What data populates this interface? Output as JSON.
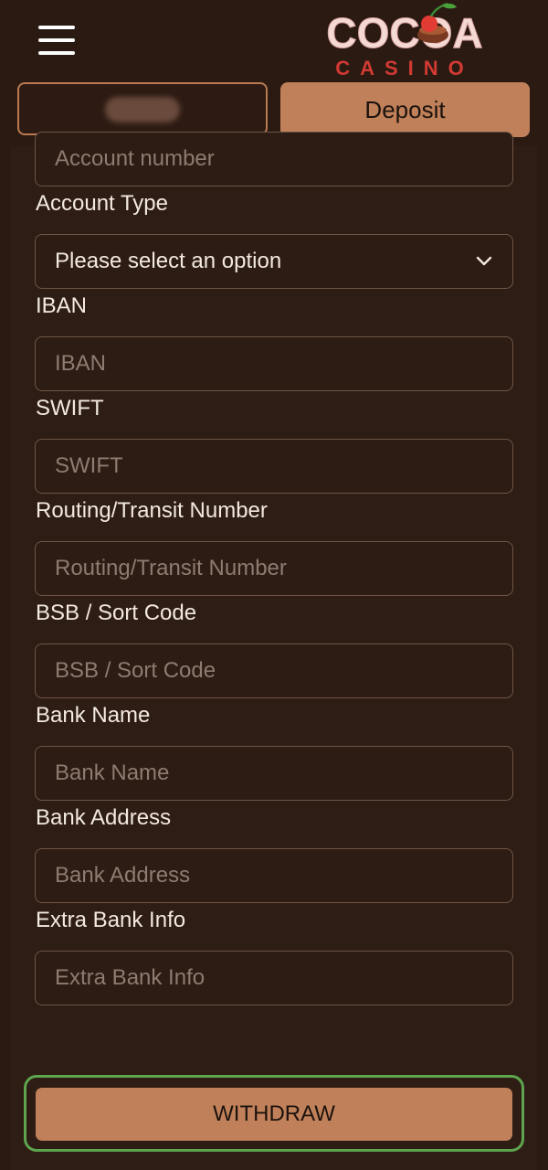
{
  "header": {
    "logo_top": "COCOA",
    "logo_bottom": "CASINO",
    "deposit_label": "Deposit"
  },
  "form": {
    "account_number": {
      "placeholder": "Account number"
    },
    "account_type": {
      "label": "Account Type",
      "value": "Please select an option"
    },
    "iban": {
      "label": "IBAN",
      "placeholder": "IBAN"
    },
    "swift": {
      "label": "SWIFT",
      "placeholder": "SWIFT"
    },
    "routing": {
      "label": "Routing/Transit Number",
      "placeholder": "Routing/Transit Number"
    },
    "bsb": {
      "label": "BSB / Sort Code",
      "placeholder": "BSB / Sort Code"
    },
    "bank_name": {
      "label": "Bank Name",
      "placeholder": "Bank Name"
    },
    "bank_address": {
      "label": "Bank Address",
      "placeholder": "Bank Address"
    },
    "extra_info": {
      "label": "Extra Bank Info",
      "placeholder": "Extra Bank Info"
    }
  },
  "withdraw_label": "WITHDRAW",
  "colors": {
    "background": "#2a1a12",
    "accent": "#c0815a",
    "focus_ring": "#5ea54f"
  },
  "icons": {
    "menu": "hamburger-icon",
    "select": "chevron-down-icon",
    "logo_cherry": "cherry-icon"
  }
}
